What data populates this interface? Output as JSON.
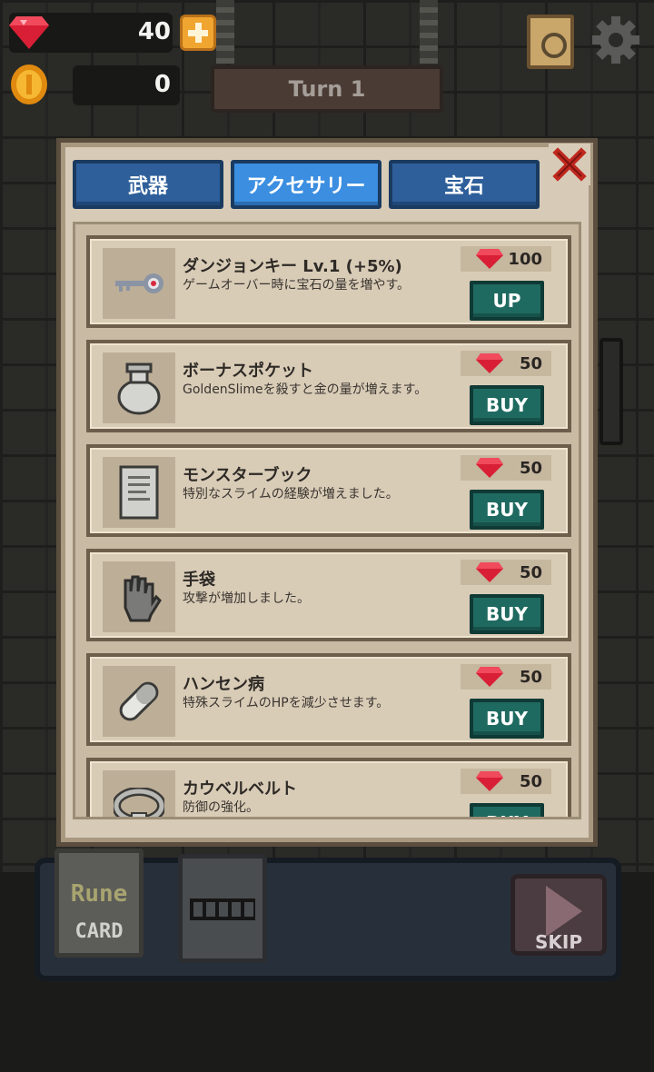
{
  "hud": {
    "gem_count": "40",
    "coin_count": "0",
    "turn_label": "Turn 1",
    "gem_icon": "ruby-gem-icon",
    "coin_icon": "gold-coin-icon"
  },
  "shop": {
    "tabs": [
      {
        "label": "武器",
        "active": false
      },
      {
        "label": "アクセサリー",
        "active": true
      },
      {
        "label": "宝石",
        "active": false
      }
    ],
    "items": [
      {
        "name": "ダンジョンキー Lv.1 (+5%)",
        "desc": "ゲームオーバー時に宝石の量を増やす。",
        "price": "100",
        "action": "UP",
        "icon": "key-icon"
      },
      {
        "name": "ボーナスポケット",
        "desc": "GoldenSlimeを殺すと金の量が増えます。",
        "price": "50",
        "action": "BUY",
        "icon": "pouch-icon"
      },
      {
        "name": "モンスターブック",
        "desc": "特別なスライムの経験が増えました。",
        "price": "50",
        "action": "BUY",
        "icon": "book-icon"
      },
      {
        "name": "手袋",
        "desc": "攻撃が増加しました。",
        "price": "50",
        "action": "BUY",
        "icon": "glove-icon"
      },
      {
        "name": "ハンセン病",
        "desc": "特殊スライムのHPを減少させます。",
        "price": "50",
        "action": "BUY",
        "icon": "pill-icon"
      },
      {
        "name": "カウベルベルト",
        "desc": "防御の強化。",
        "price": "50",
        "action": "BUY",
        "icon": "belt-icon"
      }
    ]
  },
  "bottom": {
    "rune_line1": "Rune",
    "rune_line2": "CARD",
    "skip_label": "SKIP"
  },
  "colors": {
    "gem": "#e0243a",
    "tab_active": "#3b8ee0",
    "tab_inactive": "#2e5f9a",
    "buy_button": "#1f6a60",
    "panel": "#d7cbb8"
  }
}
